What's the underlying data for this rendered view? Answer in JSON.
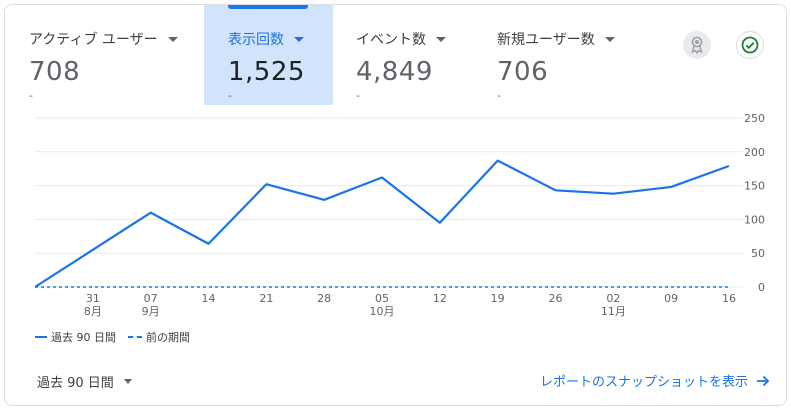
{
  "metrics": [
    {
      "label": "アクティブ ユーザー",
      "value": "708",
      "change": "-"
    },
    {
      "label": "表示回数",
      "value": "1,525",
      "change": "-"
    },
    {
      "label": "イベント数",
      "value": "4,849",
      "change": "-"
    },
    {
      "label": "新規ユーザー数",
      "value": "706",
      "change": "-"
    }
  ],
  "icons": {
    "insights": "ribbon-icon",
    "status": "check-circle-icon"
  },
  "colors": {
    "accent": "#1a73e8",
    "selected_bg": "#d2e3fc",
    "success": "#188038"
  },
  "chart_data": {
    "type": "line",
    "x": [
      "31",
      "07",
      "14",
      "21",
      "28",
      "05",
      "12",
      "19",
      "26",
      "02",
      "09",
      "16"
    ],
    "x_month_labels": [
      {
        "at": "31",
        "label": "8月"
      },
      {
        "at": "07",
        "label": "9月"
      },
      {
        "at": "05",
        "label": "10月"
      },
      {
        "at": "02",
        "label": "11月"
      }
    ],
    "series": [
      {
        "name": "過去 90 日間",
        "values": [
          0,
          55,
          110,
          64,
          152,
          129,
          162,
          95,
          187,
          143,
          138,
          148,
          179
        ]
      },
      {
        "name": "前の期間",
        "values": [
          0,
          0,
          0,
          0,
          0,
          0,
          0,
          0,
          0,
          0,
          0,
          0,
          0
        ]
      }
    ],
    "yticks": [
      0,
      50,
      100,
      150,
      200,
      250
    ],
    "ylim": [
      0,
      250
    ],
    "grid": true,
    "legend_position": "bottom-left"
  },
  "legend": {
    "current": "過去 90 日間",
    "previous": "前の期間"
  },
  "footer": {
    "period": "過去 90 日間",
    "report_link": "レポートのスナップショットを表示"
  }
}
